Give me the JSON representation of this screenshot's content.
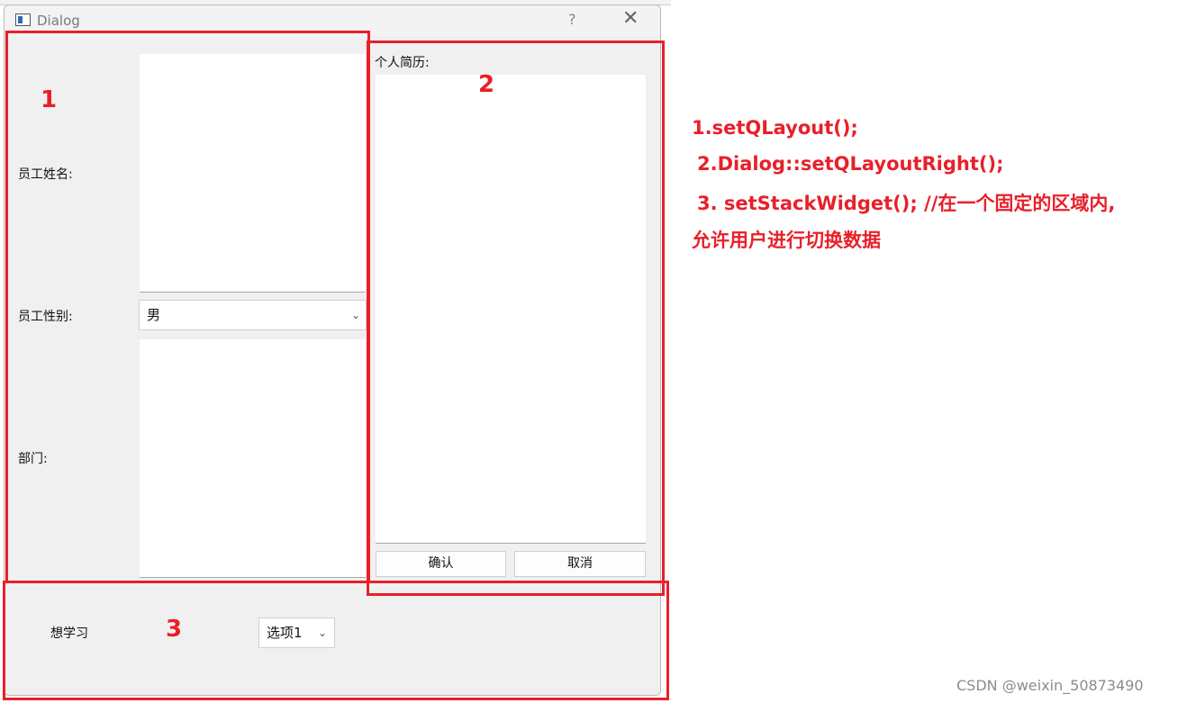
{
  "window": {
    "title": "Dialog",
    "help_glyph": "?",
    "close_glyph": "✕"
  },
  "left_form": {
    "name_label": "员工姓名:",
    "gender_label": "员工性别:",
    "gender_value": "男",
    "dept_label": "部门:"
  },
  "right_panel": {
    "resume_label": "个人简历:",
    "confirm_label": "确认",
    "cancel_label": "取消"
  },
  "bottom": {
    "want_label": "想学习",
    "option_value": "选项1"
  },
  "annotations": {
    "box1": "1",
    "box2": "2",
    "box3": "3",
    "line1": "1.setQLayout();",
    "line2": "2.Dialog::setQLayoutRight();",
    "line3": "3. setStackWidget(); //在一个固定的区域内,",
    "line4": "允许用户进行切换数据"
  },
  "watermark": "CSDN @weixin_50873490",
  "colors": {
    "annotation": "#e8202a",
    "dialog_bg": "#f0f0f0"
  }
}
